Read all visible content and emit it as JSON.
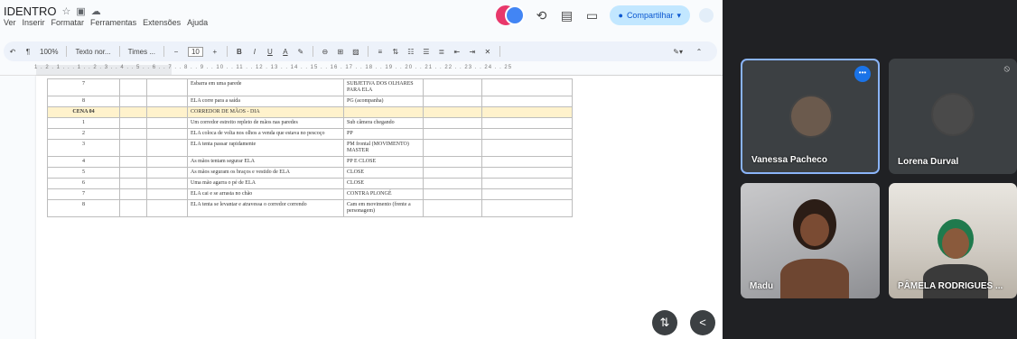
{
  "docs": {
    "title": "IDENTRO",
    "title_icons": [
      "star-icon",
      "folder-move-icon",
      "cloud-status-icon"
    ],
    "menu": [
      "Ver",
      "Inserir",
      "Formatar",
      "Ferramentas",
      "Extensões",
      "Ajuda"
    ],
    "share_label": "Compartilhar",
    "toolbar": {
      "zoom": "100%",
      "style": "Texto nor...",
      "font": "Times ...",
      "font_size": "10",
      "bold": "B",
      "italic": "I",
      "underline": "U",
      "text_color": "A"
    },
    "ruler": "1 . 2 . 1 . . . 1 . . 2 . 3 . . 4 . . 5 . . 6 . . 7 . . 8 . . 9 . . 10 . . 11 . . 12 . 13 . . 14 . . 15 . . 16 . 17 . . 18 . . 19 . . 20 . . 21 . . 22 . . 23 . . 24 . . 25",
    "table": {
      "rows": [
        {
          "scene": false,
          "num": "7",
          "desc": "Esbarra em uma parede",
          "shot": "SUBJETIVA DOS OLHARES PARA ELA"
        },
        {
          "scene": false,
          "num": "8",
          "desc": "ELA corre para a saída",
          "shot": "PG (acompanha)"
        },
        {
          "scene": true,
          "num": "CENA 04",
          "desc": "CORREDOR DE MÃOS - DIA",
          "shot": ""
        },
        {
          "scene": false,
          "num": "1",
          "desc": "Um corredor estreito repleto de mãos nas paredes",
          "shot": "Sub câmera chegando"
        },
        {
          "scene": false,
          "num": "2",
          "desc": "ELA coloca de volta nos olhos a venda que estava no pescoço",
          "shot": "PP"
        },
        {
          "scene": false,
          "num": "3",
          "desc": "ELA tenta passar rapidamente",
          "shot": "PM frontal (MOVIMENTO) MASTER"
        },
        {
          "scene": false,
          "num": "4",
          "desc": "As mãos tentam segurar ELA",
          "shot": "PP E CLOSE"
        },
        {
          "scene": false,
          "num": "5",
          "desc": "As mãos seguram os braços e vestido de ELA",
          "shot": "CLOSE"
        },
        {
          "scene": false,
          "num": "6",
          "desc": "Uma mão agarra o pé de ELA",
          "shot": "CLOSE"
        },
        {
          "scene": false,
          "num": "7",
          "desc": "ELA cai e se arrasta no chão",
          "shot": "CONTRA PLONGÉ"
        },
        {
          "scene": false,
          "num": "8",
          "desc": "ELA tenta se levantar e atravessa o corredor correndo",
          "shot": "Cam em movimento (frente a personagem)"
        }
      ]
    }
  },
  "meet": {
    "participants": [
      {
        "name": "Vanessa Pacheco",
        "active": true
      },
      {
        "name": "Lorena Durval",
        "active": false
      },
      {
        "name": "Madu",
        "active": false
      },
      {
        "name": "PÂMELA RODRIGUES ...",
        "active": false
      }
    ]
  },
  "colors": {
    "scene_row": "#fff2cc",
    "share_bg": "#c2e7ff",
    "active_border": "#8ab4f8",
    "meet_bg": "#202124"
  }
}
